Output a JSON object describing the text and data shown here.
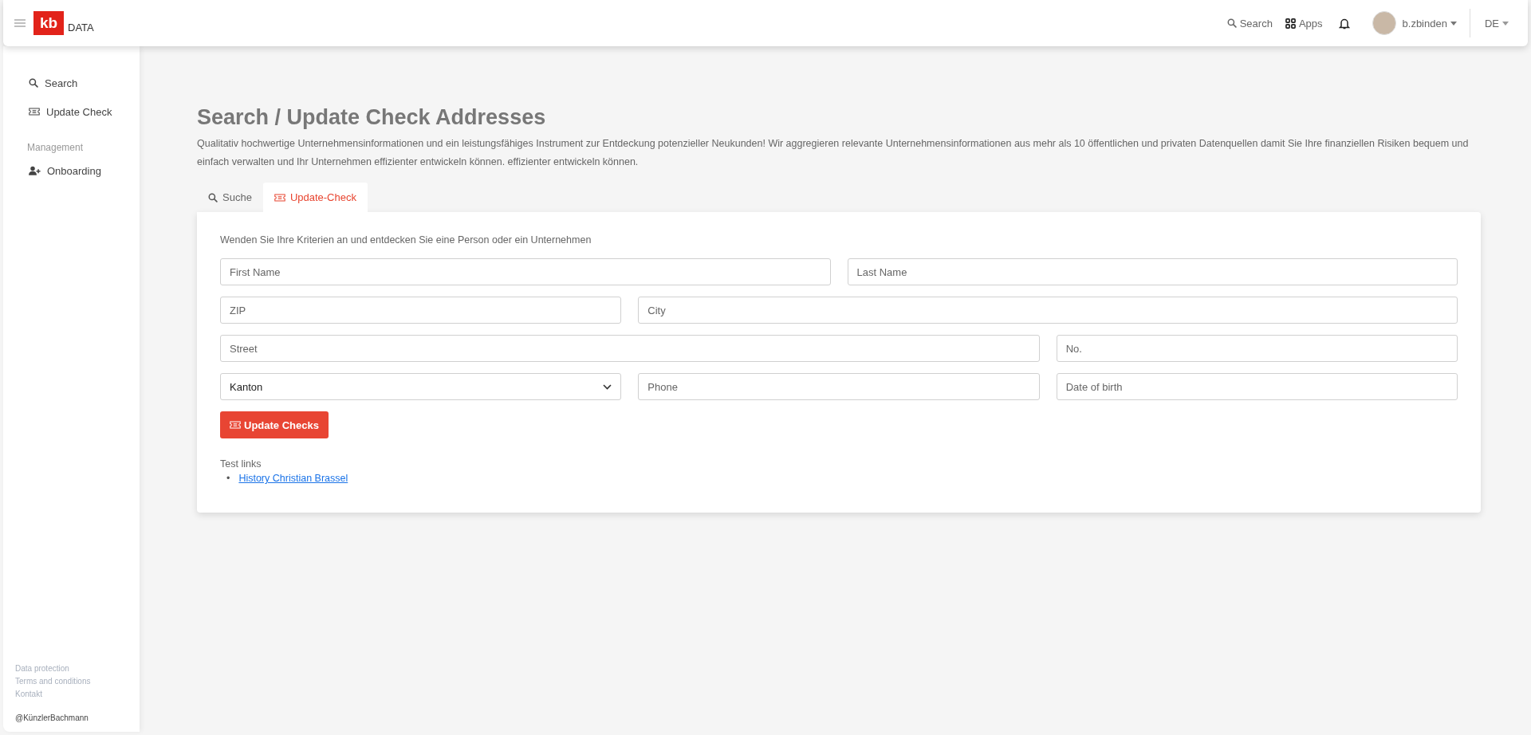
{
  "header": {
    "logo_mark": "kb",
    "logo_text": "DATA",
    "search": "Search",
    "apps": "Apps",
    "user": "b.zbinden",
    "language": "DE"
  },
  "sidebar": {
    "items": [
      {
        "label": "Search",
        "kind": "search",
        "selected": false
      },
      {
        "label": "Update Check",
        "kind": "ticket",
        "selected": false
      }
    ],
    "section": "Management",
    "section_items": [
      {
        "label": "Onboarding",
        "kind": "user-plus",
        "selected": false
      }
    ],
    "footer_links": [
      "Data protection",
      "Terms and conditions",
      "Kontakt"
    ],
    "copyright": "@KünzlerBachmann"
  },
  "page": {
    "title": "Search / Update Check Addresses",
    "description": "Qualitativ hochwertige Unternehmensinformationen und ein leistungsfähiges Instrument zur Entdeckung potenzieller Neukunden! Wir aggregieren relevante Unternehmensinformationen aus mehr als 10 öffentlichen und privaten Datenquellen damit Sie Ihre finanziellen Risiken bequem und einfach verwalten und Ihr Unternehmen effizienter entwickeln können. effizienter entwickeln können."
  },
  "tabs": [
    {
      "label": "Suche",
      "kind": "search",
      "selected": false
    },
    {
      "label": "Update-Check",
      "kind": "ticket",
      "selected": true
    }
  ],
  "form": {
    "intro": "Wenden Sie Ihre Kriterien an und entdecken Sie eine Person oder ein Unternehmen",
    "fields": [
      {
        "kind": "text",
        "placeholder": "First Name"
      },
      {
        "kind": "text",
        "placeholder": "Last Name"
      },
      {
        "kind": "text",
        "placeholder": "ZIP"
      },
      {
        "kind": "text",
        "placeholder": "City"
      },
      {
        "kind": "text",
        "placeholder": "Street"
      },
      {
        "kind": "text",
        "placeholder": "No."
      },
      {
        "kind": "select",
        "value": "Kanton"
      },
      {
        "kind": "text",
        "placeholder": "Phone"
      },
      {
        "kind": "text",
        "placeholder": "Date of birth"
      }
    ],
    "button": "Update Checks",
    "links_title": "Test links",
    "links": [
      {
        "bullet": "•",
        "label": "History Christian Brassel"
      }
    ]
  }
}
